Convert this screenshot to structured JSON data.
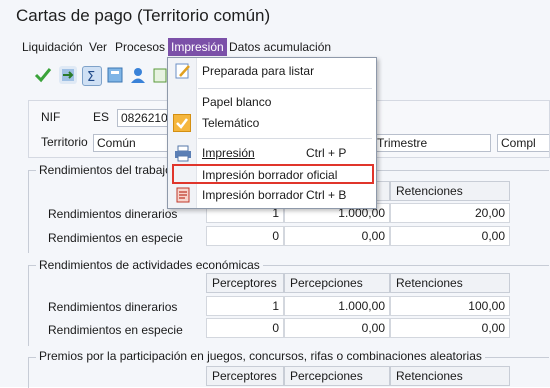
{
  "window": {
    "title": "Cartas de pago (Territorio común)"
  },
  "menubar": {
    "items": [
      "Liquidación",
      "Ver",
      "Procesos",
      "Impresión",
      "Datos acumulación"
    ]
  },
  "dropdown": {
    "items": [
      {
        "label": "Preparada para listar",
        "shortcut": ""
      },
      {
        "label": "Papel blanco",
        "shortcut": ""
      },
      {
        "label": "Telemático",
        "shortcut": "",
        "checked": true
      },
      {
        "label": "Impresión",
        "shortcut": "Ctrl + P"
      },
      {
        "label": "Impresión borrador oficial",
        "shortcut": "",
        "highlighted": true
      },
      {
        "label": "Impresión borrador",
        "shortcut": "Ctrl + B"
      }
    ]
  },
  "form": {
    "nif_label": "NIF",
    "nif_country": "ES",
    "nif_value": "0826210",
    "territorio_label": "Territorio",
    "territorio_value": "Común",
    "trimestre_label": "Trimestre",
    "compl_label": "Compl"
  },
  "sections": [
    {
      "title": "Rendimientos del trabajo",
      "headers": [
        "",
        "",
        "Retenciones"
      ],
      "rows": [
        {
          "label": "Rendimientos dinerarios",
          "perceptores": "1",
          "percepciones": "1.000,00",
          "retenciones": "20,00"
        },
        {
          "label": "Rendimientos en especie",
          "perceptores": "0",
          "percepciones": "0,00",
          "retenciones": "0,00"
        }
      ]
    },
    {
      "title": "Rendimientos de actividades económicas",
      "headers": [
        "Perceptores",
        "Percepciones",
        "Retenciones"
      ],
      "rows": [
        {
          "label": "Rendimientos dinerarios",
          "perceptores": "1",
          "percepciones": "1.000,00",
          "retenciones": "100,00"
        },
        {
          "label": "Rendimientos en especie",
          "perceptores": "0",
          "percepciones": "0,00",
          "retenciones": "0,00"
        }
      ]
    },
    {
      "title": "Premios por la participación en juegos, concursos, rifas o combinaciones aleatorias",
      "headers": [
        "Perceptores",
        "Percepciones",
        "Retenciones"
      ]
    }
  ],
  "colors": {
    "menu_active_bg": "#7b50a8",
    "highlight_border": "#e0352b",
    "check_bg": "#f5b63d"
  }
}
